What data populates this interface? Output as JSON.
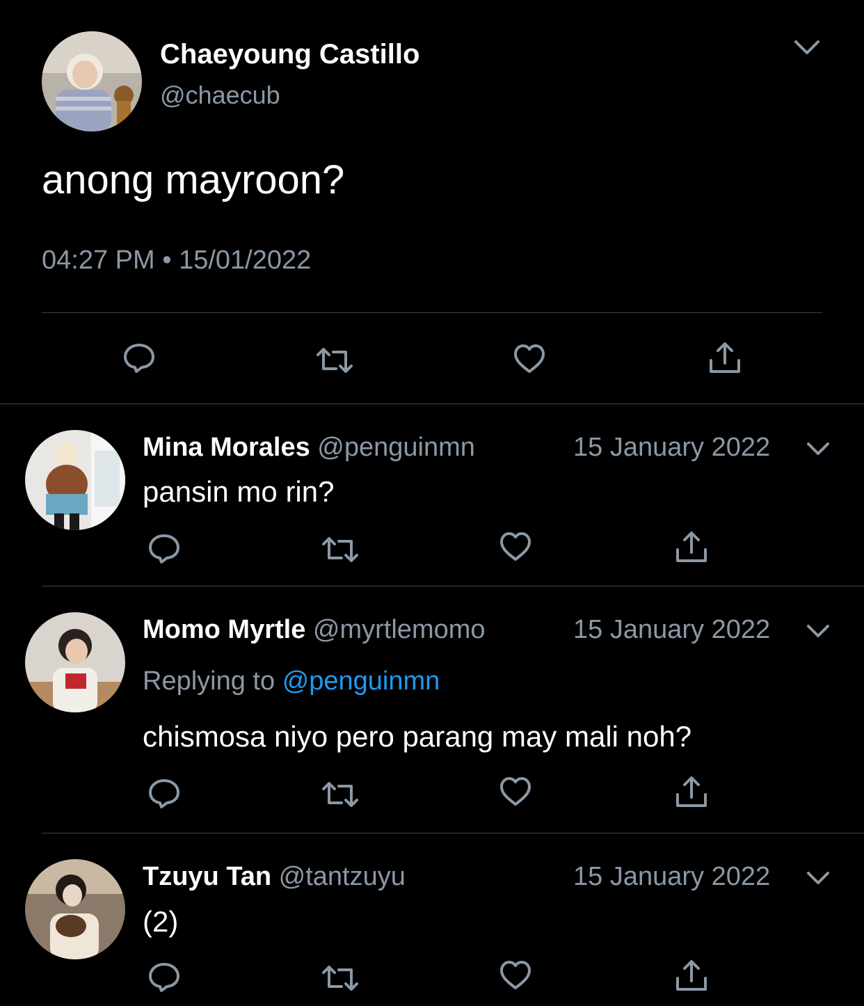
{
  "main_tweet": {
    "author_name": "Chaeyoung Castillo",
    "handle": "@chaecub",
    "text": "anong mayroon?",
    "time": "04:27 PM",
    "separator": "•",
    "date": "15/01/2022",
    "avatar_icon": "profile-photo"
  },
  "actions": {
    "icons": [
      "reply-icon",
      "retweet-icon",
      "like-icon",
      "share-icon"
    ]
  },
  "replies": [
    {
      "name": "Mina Morales",
      "handle": "@penguinmn",
      "date": "15 January 2022",
      "replying_label": "",
      "replying_to": "",
      "text": "pansin mo rin?"
    },
    {
      "name": "Momo Myrtle",
      "handle": "@myrtlemomo",
      "date": "15 January 2022",
      "replying_label": "Replying to",
      "replying_to": "@penguinmn",
      "text": "chismosa niyo pero parang may mali noh?"
    },
    {
      "name": "Tzuyu Tan",
      "handle": "@tantzuyu",
      "date": "15 January 2022",
      "replying_label": "",
      "replying_to": "",
      "text": "(2)"
    }
  ],
  "colors": {
    "background": "#000000",
    "text": "#ffffff",
    "muted": "#8b98a5",
    "link": "#1d9bf0",
    "divider": "#38444d"
  }
}
